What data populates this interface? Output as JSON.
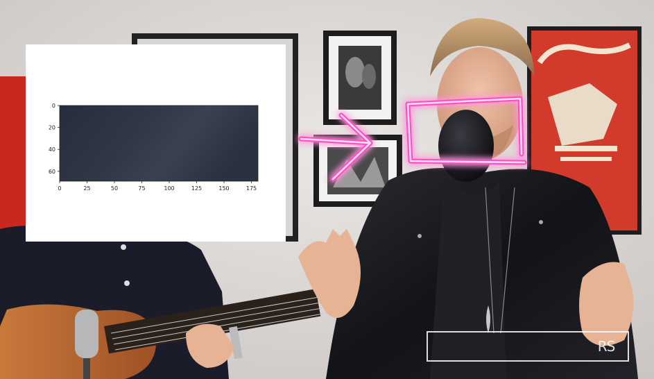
{
  "inset_plot": {
    "x_ticks": [
      "0",
      "25",
      "50",
      "75",
      "100",
      "125",
      "150",
      "175"
    ],
    "y_ticks": [
      "0",
      "20",
      "40",
      "60"
    ]
  },
  "watermark": {
    "text": "RS"
  },
  "colors": {
    "highlight": "#ff4fc8",
    "crop_fill_dark": "#232a36",
    "crop_fill_light": "#3c4454"
  }
}
